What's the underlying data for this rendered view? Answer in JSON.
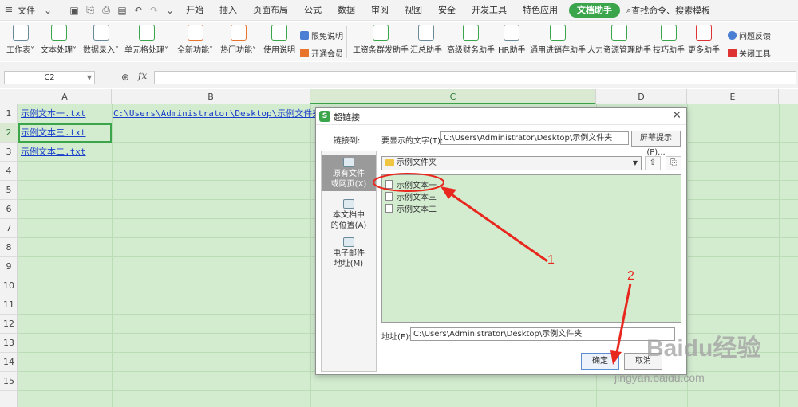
{
  "menubar": {
    "file_label": "文件",
    "tabs": [
      "开始",
      "插入",
      "页面布局",
      "公式",
      "数据",
      "审阅",
      "视图",
      "安全",
      "开发工具",
      "特色应用"
    ],
    "active_tab": "文档助手",
    "search_label": "查找命令、搜索模板"
  },
  "ribbon": {
    "buttons": [
      "工作表",
      "文本处理",
      "数据录入",
      "单元格处理",
      "全新功能",
      "热门功能",
      "使用说明"
    ],
    "small": [
      "限免说明",
      "开通会员"
    ],
    "helpers": [
      "工资条群发助手",
      "汇总助手",
      "高级财务助手",
      "HR助手",
      "通用进销存助手",
      "人力资源管理助手",
      "技巧助手",
      "更多助手"
    ],
    "side": [
      "问题反馈",
      "关闭工具"
    ]
  },
  "formula_bar": {
    "name_box": "C2",
    "fx": "fx"
  },
  "sheet": {
    "columns": [
      "A",
      "B",
      "C",
      "D",
      "E"
    ],
    "rows": [
      "1",
      "2",
      "3",
      "4",
      "5",
      "6",
      "7",
      "8",
      "9",
      "10",
      "11",
      "12",
      "13",
      "14",
      "15"
    ],
    "cells": {
      "a1": "示例文本一.txt",
      "b1": "C:\\Users\\Administrator\\Desktop\\示例文件夹",
      "a2": "示例文本三.txt",
      "a3": "示例文本二.txt"
    }
  },
  "dialog": {
    "title": "超链接",
    "link_to_label": "链接到:",
    "display_text_label": "要显示的文字(T):",
    "display_text_value": "C:\\Users\\Administrator\\Desktop\\示例文件夹",
    "screen_tip_button": "屏幕提示(P)...",
    "link_to_items": [
      {
        "line1": "原有文件",
        "line2": "或网页(X)"
      },
      {
        "line1": "本文档中",
        "line2": "的位置(A)"
      },
      {
        "line1": "电子邮件",
        "line2": "地址(M)"
      }
    ],
    "folder": "示例文件夹",
    "files": [
      "示例文本一",
      "示例文本三",
      "示例文本二"
    ],
    "address_label": "地址(E):",
    "address_value": "C:\\Users\\Administrator\\Desktop\\示例文件夹",
    "ok_label": "确定",
    "cancel_label": "取消"
  },
  "annotations": {
    "marker_1": "1",
    "marker_2": "2",
    "color": "#e8281e"
  },
  "watermark": {
    "brand": "Baidu经验",
    "url": "jingyan.baidu.com"
  },
  "colors": {
    "accent": "#3aa54a",
    "eye_care_background": "#d3ecd0",
    "hyperlink": "#1a3ec9"
  }
}
